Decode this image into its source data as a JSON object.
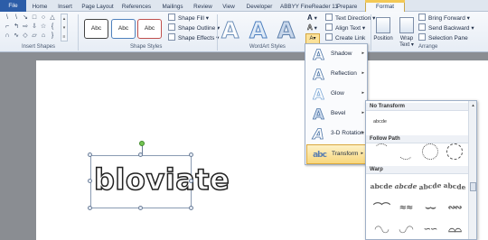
{
  "tabs": [
    "File",
    "Home",
    "Insert",
    "Page Layout",
    "References",
    "Mailings",
    "Review",
    "View",
    "Developer",
    "ABBYY FineReader 11",
    "Prepare",
    "Format"
  ],
  "ribbon": {
    "groups": {
      "insert_shapes": "Insert Shapes",
      "shape_styles": "Shape Styles",
      "wordart_styles": "WordArt Styles",
      "arrange": "Arrange"
    },
    "style_boxes": [
      "Abc",
      "Abc",
      "Abc"
    ],
    "shape_commands": {
      "fill": "Shape Fill ▾",
      "outline": "Shape Outline ▾",
      "effects": "Shape Effects ▾"
    },
    "wordart_letter": "A",
    "text_commands": {
      "direction": "Text Direction ▾",
      "align": "Align Text ▾",
      "link": "Create Link"
    },
    "arrange_buttons": {
      "position": "Position",
      "wrap": "Wrap Text ▾"
    },
    "arrange_commands": {
      "bring_forward": "Bring Forward ▾",
      "send_backward": "Send Backward ▾",
      "selection_pane": "Selection Pane"
    }
  },
  "document": {
    "wordart_text": "bloviate"
  },
  "text_effects_menu": {
    "items": [
      {
        "label": "Shadow",
        "arrow": "▸"
      },
      {
        "label": "Reflection",
        "arrow": "▸"
      },
      {
        "label": "Glow",
        "arrow": "▸"
      },
      {
        "label": "Bevel",
        "arrow": "▸"
      },
      {
        "label": "3-D Rotation",
        "arrow": "▸"
      },
      {
        "label": "Transform",
        "arrow": "▸"
      }
    ],
    "active": "Transform"
  },
  "transform_submenu": {
    "no_transform_header": "No Transform",
    "no_transform_sample": "abcde",
    "follow_path_header": "Follow Path",
    "warp_header": "Warp",
    "warp_samples": [
      "abcde",
      "abcde",
      "abcde",
      "abcde"
    ]
  },
  "colors": {
    "file_tab": "#2c5da8",
    "active_item": "#f8d77d",
    "selection_handle": "#74c453"
  }
}
